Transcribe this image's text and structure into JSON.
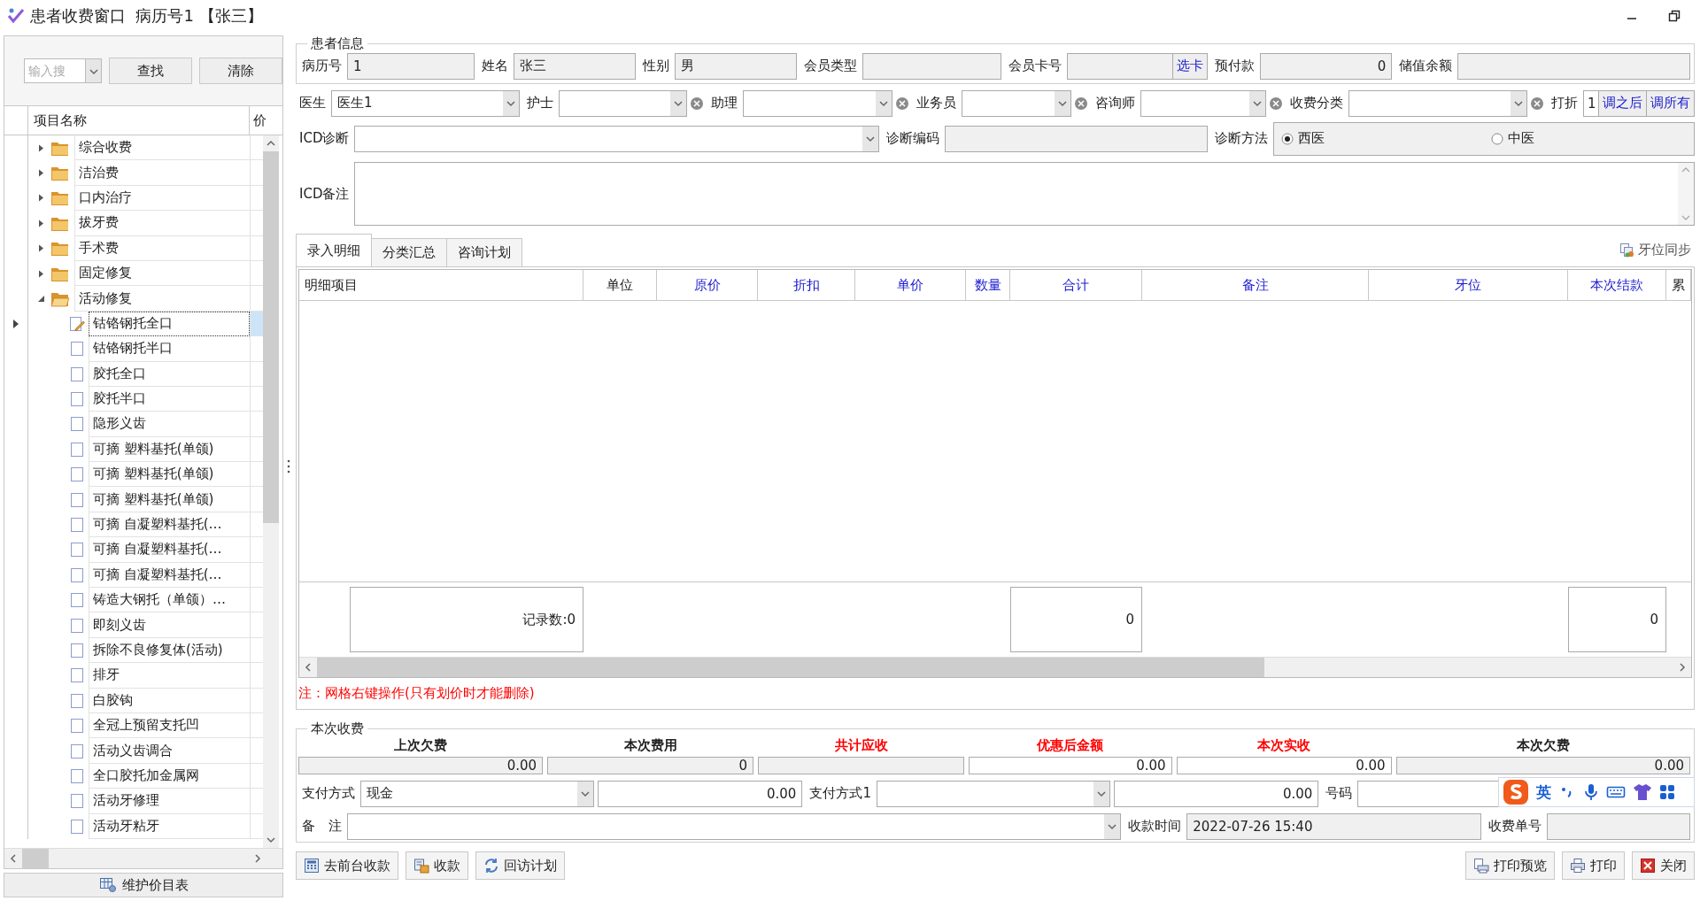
{
  "window": {
    "title": "患者收费窗口  病历号1 【张三】"
  },
  "item_tree": {
    "search": {
      "placeholder": "输入搜"
    },
    "buttons": [
      "查找",
      "清除"
    ],
    "columns": [
      "项目名称",
      "价"
    ],
    "items": [
      {
        "label": "综合收费",
        "expanded": false
      },
      {
        "label": "洁治费",
        "expanded": false
      },
      {
        "label": "口内治疗",
        "expanded": false
      },
      {
        "label": "拔牙费",
        "expanded": false
      },
      {
        "label": "手术费",
        "expanded": false
      },
      {
        "label": "固定修复",
        "expanded": false
      },
      {
        "label": "活动修复",
        "expanded": true,
        "children": [
          {
            "label": "钴铬钢托全口",
            "selected": true
          },
          {
            "label": "钴铬钢托半口",
            "selected": false
          },
          {
            "label": "胶托全口",
            "selected": false
          },
          {
            "label": "胶托半口",
            "selected": false
          },
          {
            "label": "隐形义齿",
            "selected": false
          },
          {
            "label": "可摘 塑料基托(单颌)",
            "selected": false
          },
          {
            "label": "可摘 塑料基托(单颌)",
            "selected": false
          },
          {
            "label": "可摘 塑料基托(单颌)",
            "selected": false
          },
          {
            "label": "可摘 自凝塑料基托(…",
            "selected": false
          },
          {
            "label": "可摘 自凝塑料基托(…",
            "selected": false
          },
          {
            "label": "可摘 自凝塑料基托(…",
            "selected": false
          },
          {
            "label": "铸造大钢托（单颌）…",
            "selected": false
          },
          {
            "label": "即刻义齿",
            "selected": false
          },
          {
            "label": "拆除不良修复体(活动)",
            "selected": false
          },
          {
            "label": "排牙",
            "selected": false
          },
          {
            "label": "白胶钩",
            "selected": false
          },
          {
            "label": "全冠上预留支托凹",
            "selected": false
          },
          {
            "label": "活动义齿调合",
            "selected": false
          },
          {
            "label": "全口胶托加金属网",
            "selected": false
          },
          {
            "label": "活动牙修理",
            "selected": false
          },
          {
            "label": "活动牙粘牙",
            "selected": false
          }
        ]
      }
    ],
    "maintain_button": "维护价目表"
  },
  "patient_info": {
    "title": "患者信息",
    "rows": [
      {
        "fields": [
          {
            "label": "病历号",
            "kind": "readonly",
            "value": "1"
          },
          {
            "label": "姓名",
            "kind": "readonly",
            "value": "张三"
          },
          {
            "label": "性别",
            "kind": "readonly",
            "value": "男"
          },
          {
            "label": "会员类型",
            "kind": "readonly"
          },
          {
            "label": "会员卡号",
            "kind": "readonly",
            "button": "选卡"
          },
          {
            "label": "预付款",
            "kind": "readonly",
            "value": "0",
            "numeric": true
          },
          {
            "label": "储值余额",
            "kind": "readonly"
          }
        ]
      },
      {
        "fields": [
          {
            "label": "医生",
            "kind": "combo",
            "value": "医生1"
          },
          {
            "label": "护士",
            "kind": "combo_clear"
          },
          {
            "label": "助理",
            "kind": "combo_clear"
          },
          {
            "label": "业务员",
            "kind": "combo_clear"
          },
          {
            "label": "咨询师",
            "kind": "combo_clear"
          },
          {
            "label": "收费分类",
            "kind": "combo_clear"
          },
          {
            "label": "打折",
            "kind": "discount",
            "value": "1",
            "buttons": [
              "调之后",
              "调所有"
            ]
          }
        ]
      },
      {
        "fields": [
          {
            "label": "ICD诊断",
            "kind": "combo"
          },
          {
            "label": "诊断编码",
            "kind": "readonly"
          },
          {
            "label": "诊断方法",
            "kind": "radio",
            "options": [
              {
                "label": "西医",
                "selected": true
              },
              {
                "label": "中医",
                "selected": false
              }
            ]
          }
        ]
      }
    ],
    "remark": {
      "label": "ICD备注"
    }
  },
  "tabs": [
    {
      "label": "录入明细",
      "selected": true
    },
    {
      "label": "分类汇总",
      "selected": false
    },
    {
      "label": "咨询计划",
      "selected": false
    }
  ],
  "sync_link": "牙位同步",
  "detail_grid": {
    "columns": [
      {
        "label": "明细项目",
        "highlighted": false,
        "footer": "记录数:0"
      },
      {
        "label": "单位",
        "highlighted": false
      },
      {
        "label": "原价",
        "highlighted": true
      },
      {
        "label": "折扣",
        "highlighted": true
      },
      {
        "label": "单价",
        "highlighted": true
      },
      {
        "label": "数量",
        "highlighted": true
      },
      {
        "label": "合计",
        "highlighted": true,
        "footer": "0"
      },
      {
        "label": "备注",
        "highlighted": true
      },
      {
        "label": "牙位",
        "highlighted": true
      },
      {
        "label": "本次结款",
        "highlighted": true,
        "footer": "0"
      },
      {
        "label": "累",
        "highlighted": false
      }
    ],
    "note": "注：网格右键操作(只有划价时才能删除)"
  },
  "charge": {
    "title": "本次收费",
    "summary": [
      {
        "label": "上次欠费",
        "emphasized": false,
        "readonly": true,
        "value": "0.00"
      },
      {
        "label": "本次费用",
        "emphasized": false,
        "readonly": true,
        "value": "0"
      },
      {
        "label": "共计应收",
        "emphasized": true,
        "readonly": true
      },
      {
        "label": "优惠后金额",
        "emphasized": true,
        "readonly": false,
        "value": "0.00"
      },
      {
        "label": "本次实收",
        "emphasized": true,
        "readonly": false,
        "value": "0.00"
      },
      {
        "label": "本次欠费",
        "emphasized": false,
        "readonly": true,
        "value": "0.00"
      }
    ],
    "payment": [
      {
        "label": "支付方式",
        "value": "现金",
        "amount": "0.00"
      },
      {
        "label": "支付方式1",
        "amount": "0.00"
      }
    ],
    "number_label": "号码",
    "remark_label": "备　注",
    "time": {
      "label": "收款时间",
      "value": "2022-07-26 15:40"
    },
    "receipt_label": "收费单号"
  },
  "actions_left": [
    {
      "label": "去前台收款",
      "kind": "calculator"
    },
    {
      "label": "收款",
      "kind": "money"
    },
    {
      "label": "回访计划",
      "kind": "refresh"
    }
  ],
  "actions_right": [
    {
      "label": "打印预览",
      "kind": "preview"
    },
    {
      "label": "打印",
      "kind": "printer"
    },
    {
      "label": "关闭",
      "kind": "close"
    }
  ],
  "ime_toolbar": {
    "mode": "英"
  }
}
